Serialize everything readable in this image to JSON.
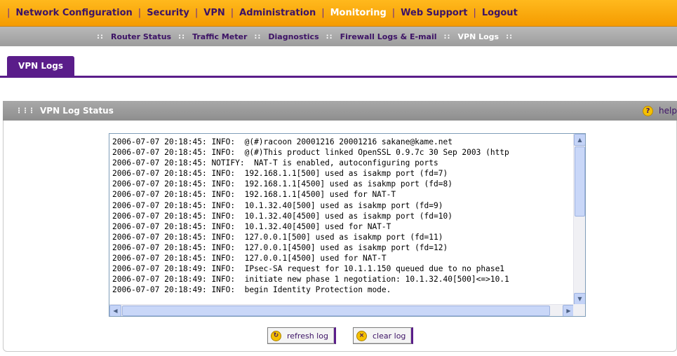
{
  "topnav": {
    "items": [
      {
        "label": "Network Configuration"
      },
      {
        "label": "Security"
      },
      {
        "label": "VPN"
      },
      {
        "label": "Administration"
      },
      {
        "label": "Monitoring"
      },
      {
        "label": "Web Support"
      },
      {
        "label": "Logout"
      }
    ],
    "separator": "|",
    "active": "Monitoring"
  },
  "subnav": {
    "items": [
      {
        "label": "Router Status"
      },
      {
        "label": "Traffic Meter"
      },
      {
        "label": "Diagnostics"
      },
      {
        "label": "Firewall Logs & E-mail"
      },
      {
        "label": "VPN Logs"
      }
    ],
    "separator": "::",
    "active": "VPN Logs"
  },
  "tab": {
    "label": "VPN Logs"
  },
  "section": {
    "title": "VPN Log Status",
    "help_label": "help"
  },
  "log": {
    "lines": [
      "2006-07-07 20:18:45: INFO:  @(#)racoon 20001216 20001216 sakane@kame.net",
      "2006-07-07 20:18:45: INFO:  @(#)This product linked OpenSSL 0.9.7c 30 Sep 2003 (http",
      "2006-07-07 20:18:45: NOTIFY:  NAT-T is enabled, autoconfiguring ports",
      "2006-07-07 20:18:45: INFO:  192.168.1.1[500] used as isakmp port (fd=7)",
      "2006-07-07 20:18:45: INFO:  192.168.1.1[4500] used as isakmp port (fd=8)",
      "2006-07-07 20:18:45: INFO:  192.168.1.1[4500] used for NAT-T",
      "2006-07-07 20:18:45: INFO:  10.1.32.40[500] used as isakmp port (fd=9)",
      "2006-07-07 20:18:45: INFO:  10.1.32.40[4500] used as isakmp port (fd=10)",
      "2006-07-07 20:18:45: INFO:  10.1.32.40[4500] used for NAT-T",
      "2006-07-07 20:18:45: INFO:  127.0.0.1[500] used as isakmp port (fd=11)",
      "2006-07-07 20:18:45: INFO:  127.0.0.1[4500] used as isakmp port (fd=12)",
      "2006-07-07 20:18:45: INFO:  127.0.0.1[4500] used for NAT-T",
      "2006-07-07 20:18:49: INFO:  IPsec-SA request for 10.1.1.150 queued due to no phase1",
      "2006-07-07 20:18:49: INFO:  initiate new phase 1 negotiation: 10.1.32.40[500]<=>10.1",
      "2006-07-07 20:18:49: INFO:  begin Identity Protection mode."
    ]
  },
  "buttons": {
    "refresh_label": "refresh log",
    "clear_label": "clear log"
  },
  "colors": {
    "topnav_bg": "#f5a300",
    "accent_purple": "#5a1d8a",
    "section_grey": "#9a9a9a"
  }
}
